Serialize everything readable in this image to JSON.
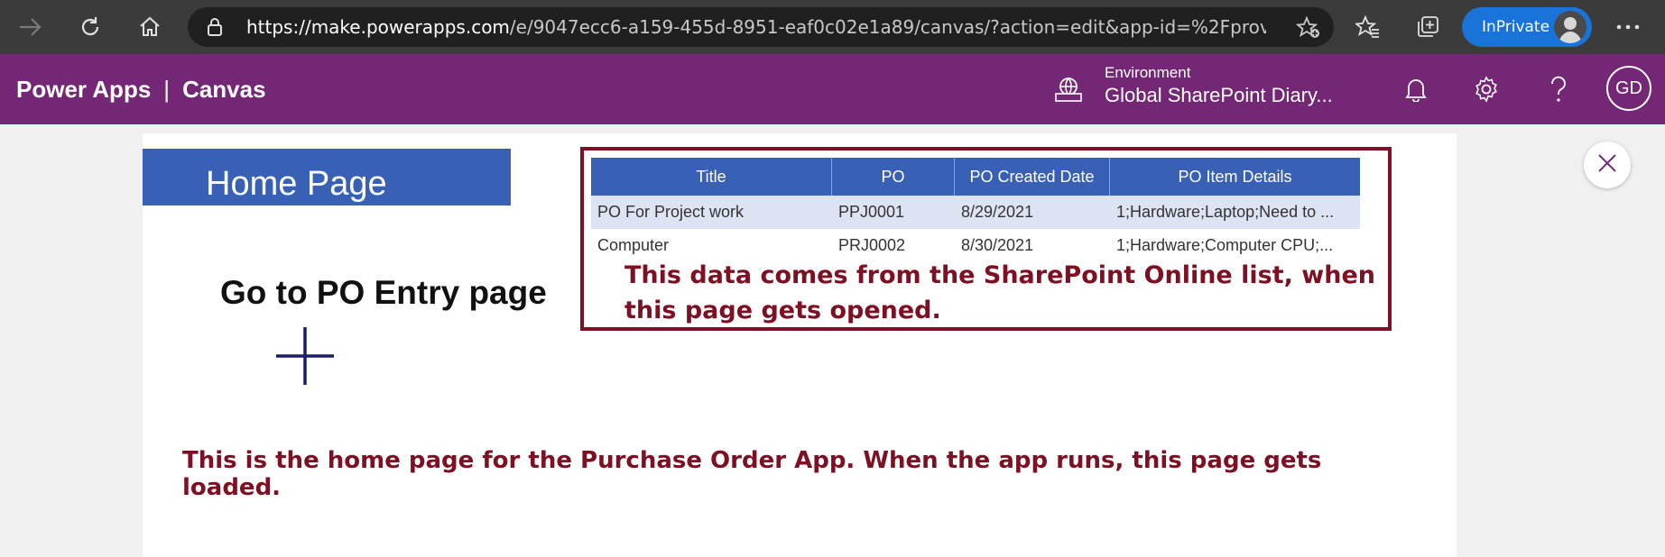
{
  "browser": {
    "url_host": "https://make.powerapps.com",
    "url_path": "/e/9047ecc6-a159-455d-8951-eaf0c02e1a89/canvas/?action=edit&app-id=%2Fproviders%...",
    "inprivate_label": "InPrivate"
  },
  "header": {
    "app_name": "Power Apps",
    "separator": "|",
    "mode": "Canvas",
    "environment_label": "Environment",
    "environment_name": "Global SharePoint Diary...",
    "user_initials": "GD",
    "color": "#742774"
  },
  "canvas": {
    "home_title": "Home Page",
    "goto_label": "Go to PO Entry page",
    "grid": {
      "columns": [
        "Title",
        "PO",
        "PO Created Date",
        "PO Item Details"
      ],
      "rows": [
        [
          "PO For Project work",
          "PPJ0001",
          "8/29/2021",
          "1;Hardware;Laptop;Need to ..."
        ],
        [
          "Computer",
          "PRJ0002",
          "8/30/2021",
          "1;Hardware;Computer CPU;..."
        ]
      ]
    },
    "note_grid": "This data comes from the SharePoint Online list, when this page gets opened.",
    "note_page": "This is the home page for the Purchase Order App. When the app runs, this page gets loaded."
  },
  "colors": {
    "accent_blue": "#3861b5",
    "annotation": "#7d1022",
    "inprivate": "#1a73d9"
  },
  "icons": [
    "forward-icon",
    "refresh-icon",
    "home-icon",
    "lock-icon",
    "add-favorite-icon",
    "favorites-icon",
    "collections-icon",
    "more-icon",
    "environment-icon",
    "bell-icon",
    "gear-icon",
    "help-icon",
    "add-icon",
    "close-icon"
  ]
}
